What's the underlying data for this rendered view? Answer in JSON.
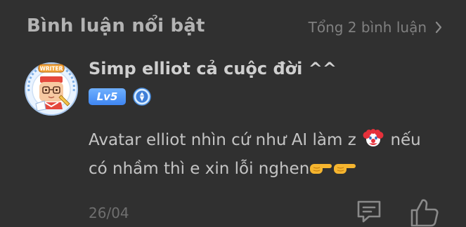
{
  "header": {
    "title": "Bình luận nổi bật",
    "total_label": "Tổng 2 bình luận",
    "chevron_icon": "chevron-right-icon"
  },
  "comment": {
    "avatar_badge_text": "WRITER",
    "username": "Simp elliot cả cuộc đời ^^",
    "level_label": "Lv5",
    "rank_icon": "diamond-rank-icon",
    "text_line1_before_emoji": "Avatar elliot nhìn cứ như AI làm z",
    "text_line1_after_emoji": "nếu",
    "text_line2": "có nhầm thì e xin lỗi nghen",
    "date": "26/04",
    "emojis": [
      "clown-face",
      "backhand-index-pointing-right",
      "backhand-index-pointing-right"
    ]
  },
  "actions": {
    "reply_icon": "comment-reply-icon",
    "like_icon": "thumbs-up-icon"
  },
  "colors": {
    "background": "#303030",
    "title": "#b3b3b3",
    "muted": "#808080",
    "level_badge": "#4a8ff5"
  }
}
